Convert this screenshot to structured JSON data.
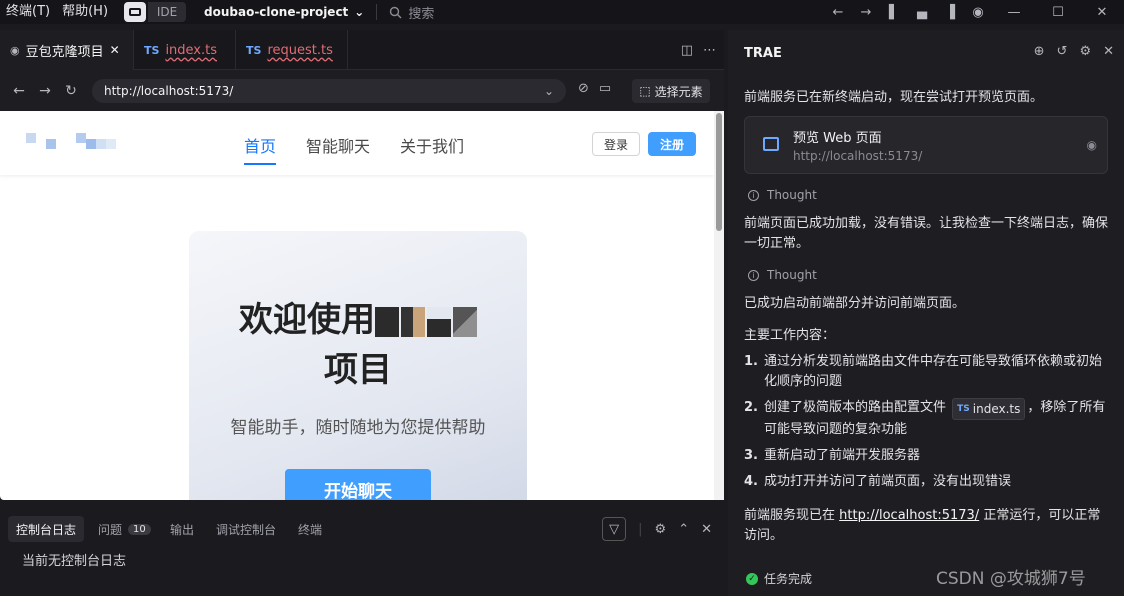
{
  "titlebar": {
    "menus": [
      "终端(T)",
      "帮助(H)"
    ],
    "ide_label": "IDE",
    "project": "doubao-clone-project",
    "search_placeholder": "搜索"
  },
  "tabs": [
    {
      "label": "豆包克隆项目",
      "active": true
    },
    {
      "badge": "TS",
      "label": "index.ts",
      "active": false
    },
    {
      "badge": "TS",
      "label": "request.ts",
      "active": false
    }
  ],
  "browser": {
    "url": "http://localhost:5173/",
    "pick_element": "选择元素"
  },
  "site": {
    "nav": [
      "首页",
      "智能聊天",
      "关于我们"
    ],
    "login": "登录",
    "register": "注册",
    "hero_title_prefix": "欢迎使用",
    "hero_title_suffix": "项目",
    "hero_subtitle": "智能助手，随时随地为您提供帮助",
    "hero_button": "开始聊天"
  },
  "panel": {
    "tabs": [
      {
        "label": "控制台日志",
        "active": true
      },
      {
        "label": "问题",
        "count": "10"
      },
      {
        "label": "输出"
      },
      {
        "label": "调试控制台"
      },
      {
        "label": "终端"
      }
    ],
    "message": "当前无控制台日志"
  },
  "chat": {
    "title": "TRAE",
    "msg1": "前端服务已在新终端启动，现在尝试打开预览页面。",
    "preview_card": {
      "title": "预览 Web 页面",
      "url": "http://localhost:5173/"
    },
    "thought_label": "Thought",
    "msg2": "前端页面已成功加载，没有错误。让我检查一下终端日志，确保一切正常。",
    "msg3": "已成功启动前端部分并访问前端页面。",
    "work_heading": "主要工作内容：",
    "items": [
      {
        "num": "1.",
        "text": "通过分析发现前端路由文件中存在可能导致循环依赖或初始化顺序的问题"
      },
      {
        "num": "2.",
        "text_before": "创建了极简版本的路由配置文件",
        "chip_badge": "TS",
        "chip_label": "index.ts",
        "text_after": "，移除了所有可能导致问题的复杂功能"
      },
      {
        "num": "3.",
        "text": "重新启动了前端开发服务器"
      },
      {
        "num": "4.",
        "text": "成功打开并访问了前端页面，没有出现错误"
      }
    ],
    "final_before": "前端服务现已在",
    "final_link": "http://localhost:5173/",
    "final_after": "正常运行，可以正常访问。",
    "task_done": "任务完成",
    "watermark": "CSDN @攻城狮7号"
  }
}
